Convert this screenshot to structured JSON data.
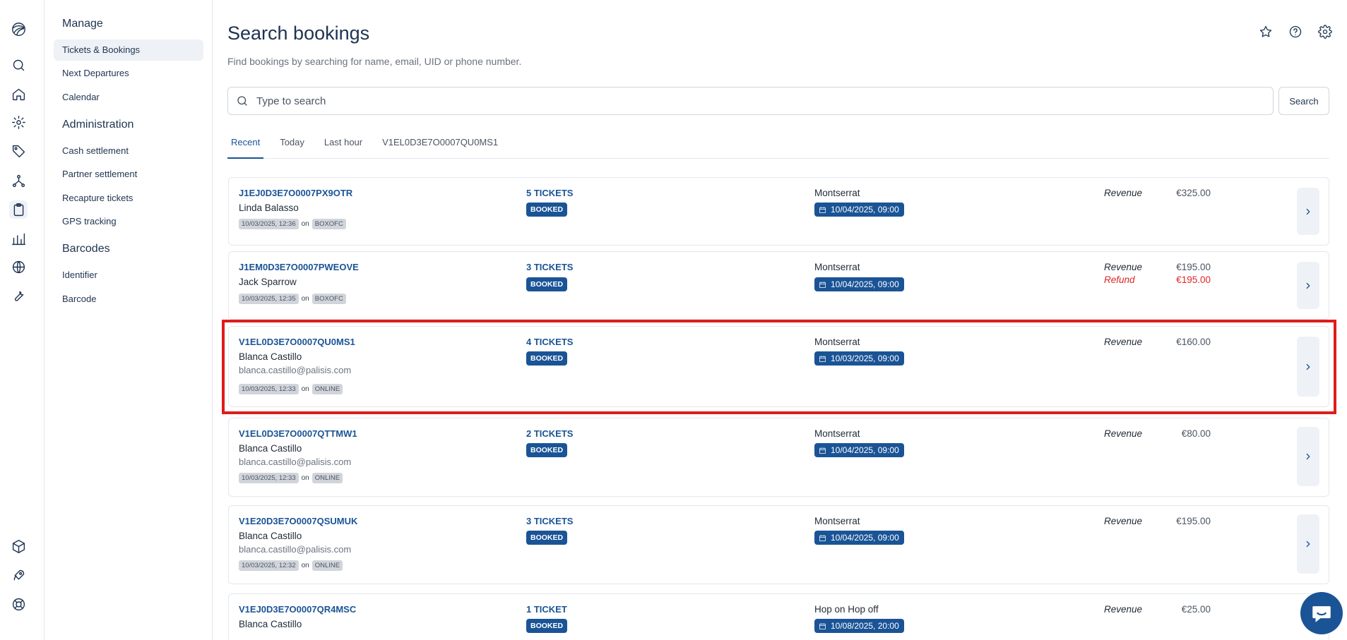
{
  "rail": {
    "icons": [
      "logo-icon",
      "search-icon",
      "home-icon",
      "settings-icon",
      "tag-icon",
      "network-icon",
      "clipboard-icon",
      "bar-chart-icon",
      "globe-icon",
      "wrench-icon",
      "box-icon",
      "rocket-icon",
      "lifebuoy-icon"
    ],
    "active": "clipboard-icon"
  },
  "nav": {
    "sections": [
      {
        "title": "Manage",
        "items": [
          "Tickets & Bookings",
          "Next Departures",
          "Calendar"
        ]
      },
      {
        "title": "Administration",
        "items": [
          "Cash settlement",
          "Partner settlement",
          "Recapture tickets",
          "GPS tracking"
        ]
      },
      {
        "title": "Barcodes",
        "items": [
          "Identifier",
          "Barcode"
        ]
      }
    ],
    "active_item": "Tickets & Bookings"
  },
  "header": {
    "title": "Search bookings",
    "subtitle": "Find bookings by searching for name, email, UID or phone number.",
    "icons": [
      "star-icon",
      "help-icon",
      "gear-icon"
    ]
  },
  "search": {
    "placeholder": "Type to search",
    "value": "",
    "button_label": "Search"
  },
  "tabs": {
    "items": [
      "Recent",
      "Today",
      "Last hour",
      "V1EL0D3E7O0007QU0MS1"
    ],
    "active": "Recent"
  },
  "bookings": [
    {
      "uid": "J1EJ0D3E7O0007PX9OTR",
      "name": "Linda Balasso",
      "email": "",
      "created": "10/03/2025, 12:36",
      "on": "on",
      "channel": "BOXOFC",
      "tickets": "5 TICKETS",
      "status": "BOOKED",
      "route": "Montserrat",
      "departure": "10/04/2025, 09:00",
      "revenue_label": "Revenue",
      "revenue": "€325.00",
      "refund_label": "",
      "refund": ""
    },
    {
      "uid": "J1EM0D3E7O0007PWEOVE",
      "name": "Jack Sparrow",
      "email": "",
      "created": "10/03/2025, 12:35",
      "on": "on",
      "channel": "BOXOFC",
      "tickets": "3 TICKETS",
      "status": "BOOKED",
      "route": "Montserrat",
      "departure": "10/04/2025, 09:00",
      "revenue_label": "Revenue",
      "revenue": "€195.00",
      "refund_label": "Refund",
      "refund": "€195.00"
    },
    {
      "uid": "V1EL0D3E7O0007QU0MS1",
      "name": "Blanca Castillo",
      "email": "blanca.castillo@palisis.com",
      "created": "10/03/2025, 12:33",
      "on": "on",
      "channel": "ONLINE",
      "tickets": "4 TICKETS",
      "status": "BOOKED",
      "route": "Montserrat",
      "departure": "10/03/2025, 09:00",
      "revenue_label": "Revenue",
      "revenue": "€160.00",
      "refund_label": "",
      "refund": ""
    },
    {
      "uid": "V1EL0D3E7O0007QTTMW1",
      "name": "Blanca Castillo",
      "email": "blanca.castillo@palisis.com",
      "created": "10/03/2025, 12:33",
      "on": "on",
      "channel": "ONLINE",
      "tickets": "2 TICKETS",
      "status": "BOOKED",
      "route": "Montserrat",
      "departure": "10/04/2025, 09:00",
      "revenue_label": "Revenue",
      "revenue": "€80.00",
      "refund_label": "",
      "refund": ""
    },
    {
      "uid": "V1E20D3E7O0007QSUMUK",
      "name": "Blanca Castillo",
      "email": "blanca.castillo@palisis.com",
      "created": "10/03/2025, 12:32",
      "on": "on",
      "channel": "ONLINE",
      "tickets": "3 TICKETS",
      "status": "BOOKED",
      "route": "Montserrat",
      "departure": "10/04/2025, 09:00",
      "revenue_label": "Revenue",
      "revenue": "€195.00",
      "refund_label": "",
      "refund": ""
    },
    {
      "uid": "V1EJ0D3E7O0007QR4MSC",
      "name": "Blanca Castillo",
      "email": "",
      "created": "",
      "on": "",
      "channel": "",
      "tickets": "1 TICKET",
      "status": "BOOKED",
      "route": "Hop on Hop off",
      "departure": "10/08/2025, 20:00",
      "revenue_label": "Revenue",
      "revenue": "€25.00",
      "refund_label": "",
      "refund": ""
    }
  ],
  "highlighted_booking": "V1EL0D3E7O0007QU0MS1",
  "colors": {
    "accent": "#1a5496",
    "refund": "#dc2626",
    "highlight": "#e01b1b"
  }
}
